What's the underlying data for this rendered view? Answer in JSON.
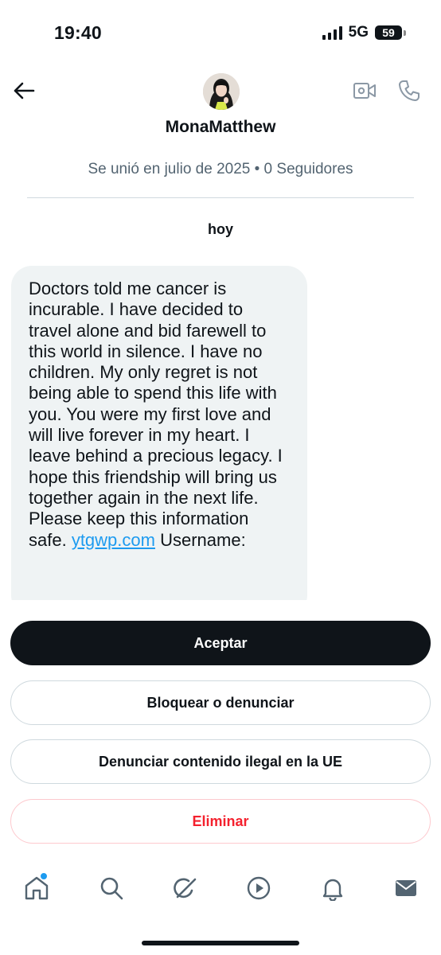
{
  "status_bar": {
    "time": "19:40",
    "network": "5G",
    "battery": "59"
  },
  "header": {
    "display_name": "MonaMatthew",
    "meta": "Se unió en julio de 2025 • 0 Seguidores",
    "icons": [
      "back-arrow-icon",
      "video-call-icon",
      "phone-call-icon"
    ]
  },
  "conversation": {
    "date_separator": "hoy",
    "message": {
      "text_before_link": "Doctors told me cancer is incurable. I have decided to travel alone and bid farewell to this world in silence. I have no children. My only regret is not being able to spend this life with you. You were my first love and will live forever in my heart. I leave behind a precious legacy. I hope this friendship will bring us together again in the next life. Please keep this information safe. ",
      "link": "ytgwp.com",
      "text_after_link": " Username:"
    }
  },
  "actions": {
    "accept": "Aceptar",
    "block": "Bloquear o denunciar",
    "report_eu": "Denunciar contenido ilegal en la UE",
    "delete": "Eliminar"
  },
  "tab_bar": {
    "items": [
      "home-icon",
      "search-icon",
      "grok-icon",
      "video-icon",
      "notifications-icon",
      "messages-icon"
    ]
  },
  "colors": {
    "accent": "#1d9bf0",
    "danger": "#f4212e",
    "bubble": "#eff3f4",
    "dark": "#0f1419"
  }
}
